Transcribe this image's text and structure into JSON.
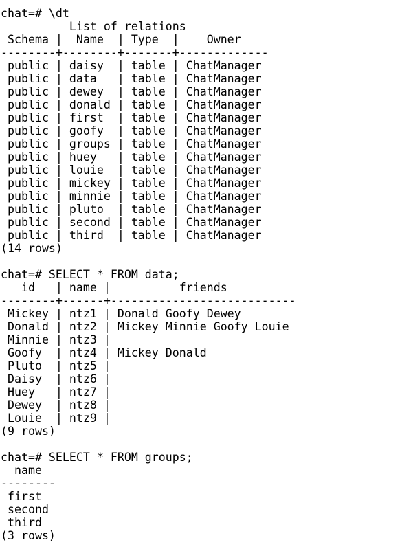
{
  "terminal": {
    "lines": [
      "chat=# \\dt",
      "          List of relations",
      " Schema |  Name  | Type  |    Owner",
      "--------+--------+-------+-------------",
      " public | daisy  | table | ChatManager",
      " public | data   | table | ChatManager",
      " public | dewey  | table | ChatManager",
      " public | donald | table | ChatManager",
      " public | first  | table | ChatManager",
      " public | goofy  | table | ChatManager",
      " public | groups | table | ChatManager",
      " public | huey   | table | ChatManager",
      " public | louie  | table | ChatManager",
      " public | mickey | table | ChatManager",
      " public | minnie | table | ChatManager",
      " public | pluto  | table | ChatManager",
      " public | second | table | ChatManager",
      " public | third  | table | ChatManager",
      "(14 rows)",
      "",
      "chat=# SELECT * FROM data;",
      "   id   | name |          friends",
      "--------+------+---------------------------",
      " Mickey | ntz1 | Donald Goofy Dewey",
      " Donald | ntz2 | Mickey Minnie Goofy Louie",
      " Minnie | ntz3 |",
      " Goofy  | ntz4 | Mickey Donald",
      " Pluto  | ntz5 |",
      " Daisy  | ntz6 |",
      " Huey   | ntz7 |",
      " Dewey  | ntz8 |",
      " Louie  | ntz9 |",
      "(9 rows)",
      "",
      "chat=# SELECT * FROM groups;",
      "  name",
      "--------",
      " first",
      " second",
      " third",
      "(3 rows)"
    ]
  }
}
